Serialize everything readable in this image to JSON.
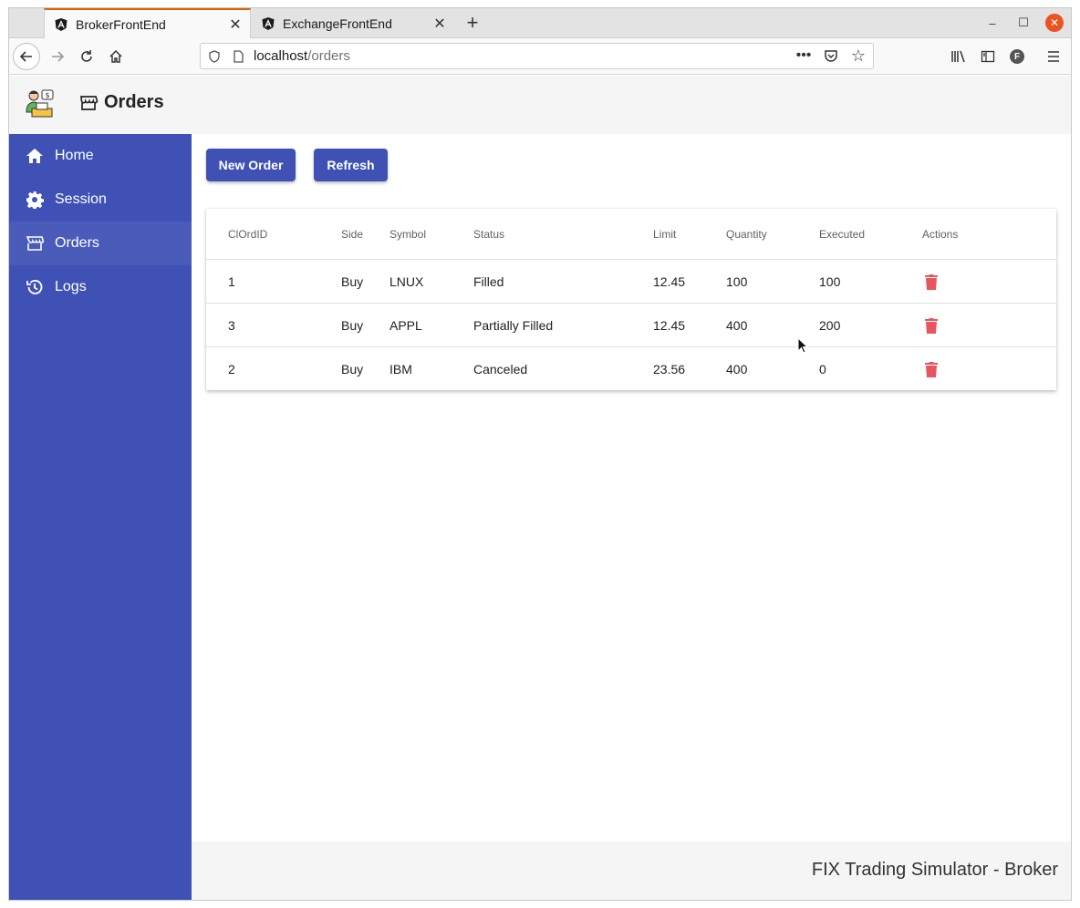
{
  "browser": {
    "tabs": [
      {
        "title": "BrokerFrontEnd",
        "icon": "angular-icon",
        "active": true
      },
      {
        "title": "ExchangeFrontEnd",
        "icon": "angular-icon",
        "active": false
      }
    ],
    "url_host": "localhost",
    "url_path": "/orders",
    "profile_initial": "F"
  },
  "app": {
    "page_title": "Orders",
    "sidebar": {
      "items": [
        {
          "label": "Home",
          "icon": "home-icon"
        },
        {
          "label": "Session",
          "icon": "gear-icon"
        },
        {
          "label": "Orders",
          "icon": "store-icon",
          "active": true
        },
        {
          "label": "Logs",
          "icon": "history-icon"
        }
      ]
    },
    "buttons": {
      "new_order": "New Order",
      "refresh": "Refresh"
    },
    "table": {
      "headers": {
        "clordid": "ClOrdID",
        "side": "Side",
        "symbol": "Symbol",
        "status": "Status",
        "limit": "Limit",
        "quantity": "Quantity",
        "executed": "Executed",
        "actions": "Actions"
      },
      "rows": [
        {
          "clordid": "1",
          "side": "Buy",
          "symbol": "LNUX",
          "status": "Filled",
          "limit": "12.45",
          "quantity": "100",
          "executed": "100"
        },
        {
          "clordid": "3",
          "side": "Buy",
          "symbol": "APPL",
          "status": "Partially Filled",
          "limit": "12.45",
          "quantity": "400",
          "executed": "200"
        },
        {
          "clordid": "2",
          "side": "Buy",
          "symbol": "IBM",
          "status": "Canceled",
          "limit": "23.56",
          "quantity": "400",
          "executed": "0"
        }
      ]
    },
    "footer": "FIX Trading Simulator - Broker",
    "colors": {
      "primary": "#3f51b5",
      "delete": "#e75660",
      "tab_accent": "#e66000"
    }
  }
}
